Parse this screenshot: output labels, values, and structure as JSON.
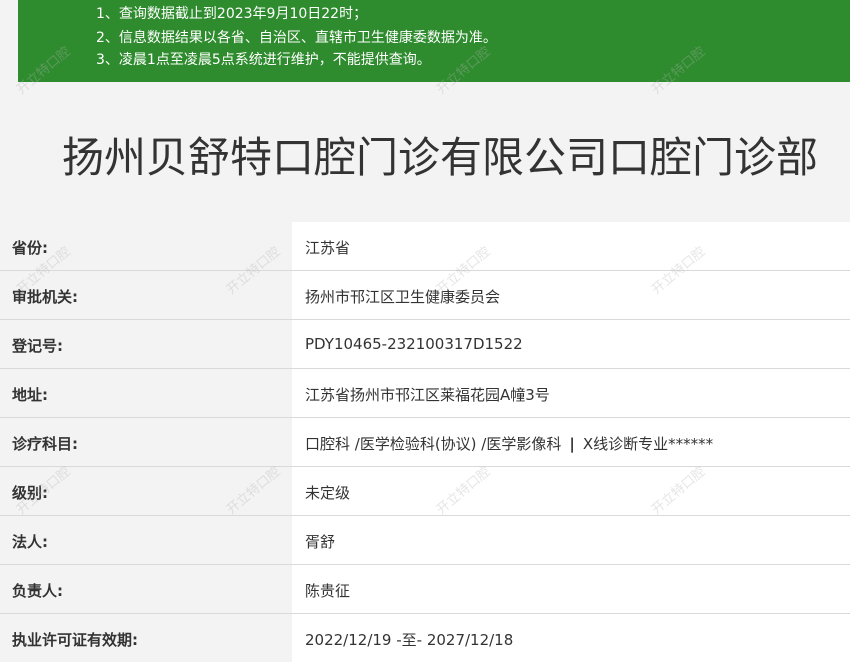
{
  "notice": {
    "lines": [
      "1、查询数据截止到2023年9月10日22时；",
      "2、信息数据结果以各省、自治区、直辖市卫生健康委数据为准。",
      "3、凌晨1点至凌晨5点系统进行维护，不能提供查询。"
    ]
  },
  "title": "扬州贝舒特口腔门诊有限公司口腔门诊部",
  "watermark": "开立特口腔",
  "rows": [
    {
      "label": "省份:",
      "value": "江苏省"
    },
    {
      "label": "审批机关:",
      "value": "扬州市邗江区卫生健康委员会"
    },
    {
      "label": "登记号:",
      "value": "PDY10465-232100317D1522"
    },
    {
      "label": "地址:",
      "value": "江苏省扬州市邗江区莱福花园A幢3号"
    },
    {
      "label": "诊疗科目:",
      "value_part1": "口腔科 /医学检验科(协议) /医学影像科",
      "separator": "|",
      "value_part2": "X线诊断专业******"
    },
    {
      "label": "级别:",
      "value": "未定级"
    },
    {
      "label": "法人:",
      "value": "胥舒"
    },
    {
      "label": "负责人:",
      "value": "陈贵征"
    },
    {
      "label": "执业许可证有效期:",
      "value": "2022/12/19 -至- 2027/12/18"
    }
  ]
}
